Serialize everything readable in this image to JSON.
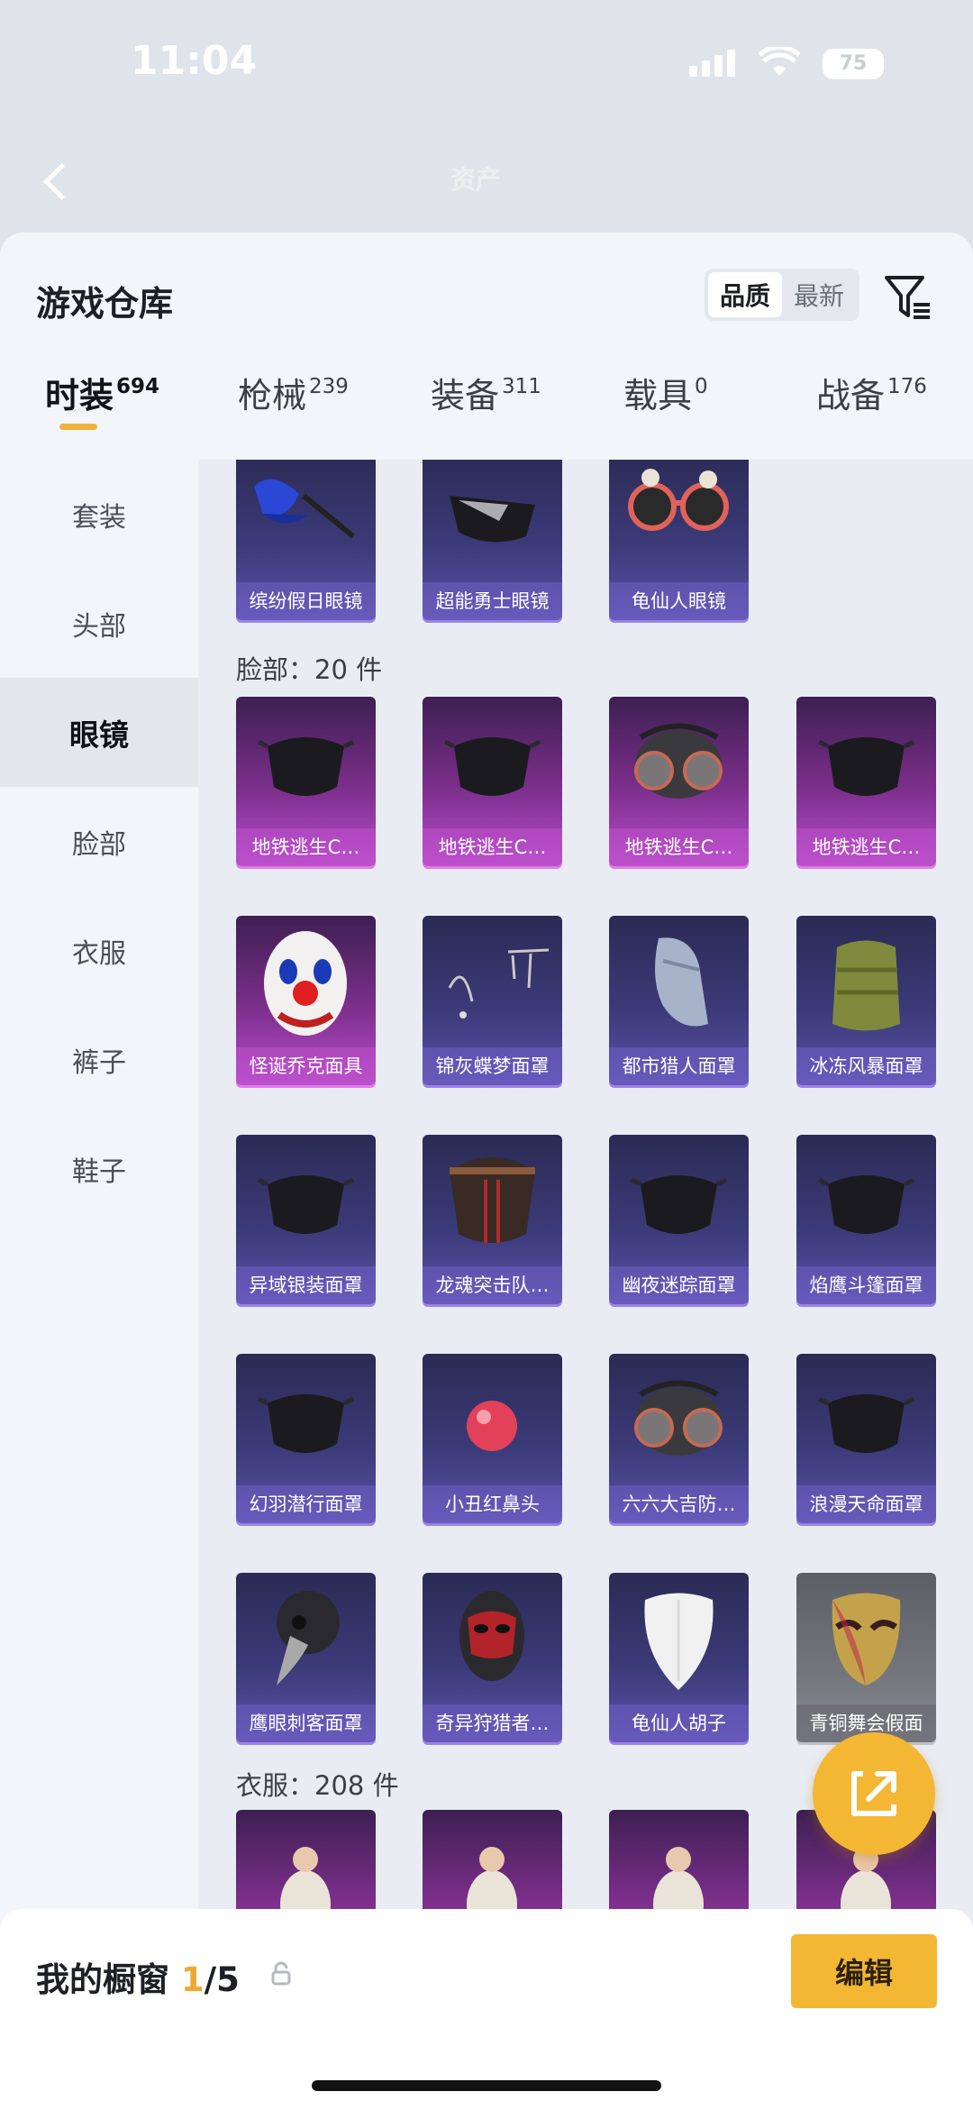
{
  "status": {
    "time": "11:04",
    "battery": "75"
  },
  "header_bg": {
    "title": "资产"
  },
  "sheet": {
    "title": "游戏仓库",
    "sort": [
      "品质",
      "最新"
    ],
    "sort_selected": "品质",
    "tabs": [
      {
        "label": "时装",
        "count": "694"
      },
      {
        "label": "枪械",
        "count": "239"
      },
      {
        "label": "装备",
        "count": "311"
      },
      {
        "label": "载具",
        "count": "0"
      },
      {
        "label": "战备",
        "count": "176"
      }
    ],
    "sidebar": [
      "套装",
      "头部",
      "眼镜",
      "脸部",
      "衣服",
      "裤子",
      "鞋子"
    ],
    "sidebar_selected": "眼镜",
    "glasses": [
      {
        "name": "缤纷假日眼镜",
        "tier": "blue",
        "icon": "sunglasses-icon"
      },
      {
        "name": "超能勇士眼镜",
        "tier": "blue",
        "icon": "visor-glasses-icon"
      },
      {
        "name": "龟仙人眼镜",
        "tier": "blue",
        "icon": "round-sunglasses-icon"
      }
    ],
    "face_header": "脸部：20 件",
    "face": [
      {
        "name": "地铁逃生C…",
        "tier": "purple",
        "icon": "mask-icon"
      },
      {
        "name": "地铁逃生C…",
        "tier": "purple",
        "icon": "mask-icon"
      },
      {
        "name": "地铁逃生C…",
        "tier": "purple",
        "icon": "gas-mask-icon"
      },
      {
        "name": "地铁逃生C…",
        "tier": "purple",
        "icon": "mask-icon"
      },
      {
        "name": "怪诞乔克面具",
        "tier": "purple",
        "icon": "clown-mask-icon"
      },
      {
        "name": "锦灰蝶梦面罩",
        "tier": "blue",
        "icon": "butterfly-icon"
      },
      {
        "name": "都市猎人面罩",
        "tier": "blue",
        "icon": "bandana-icon"
      },
      {
        "name": "冰冻风暴面罩",
        "tier": "blue",
        "icon": "neck-gaiter-icon"
      },
      {
        "name": "异域银装面罩",
        "tier": "blue",
        "icon": "mask-icon"
      },
      {
        "name": "龙魂突击队…",
        "tier": "blue",
        "icon": "assault-mask-icon"
      },
      {
        "name": "幽夜迷踪面罩",
        "tier": "blue",
        "icon": "mask-icon"
      },
      {
        "name": "焰鹰斗篷面罩",
        "tier": "blue",
        "icon": "mask-icon"
      },
      {
        "name": "幻羽潜行面罩",
        "tier": "blue",
        "icon": "mask-icon"
      },
      {
        "name": "小丑红鼻头",
        "tier": "blue",
        "icon": "red-nose-icon"
      },
      {
        "name": "六六大吉防…",
        "tier": "blue",
        "icon": "gas-mask-icon"
      },
      {
        "name": "浪漫天命面罩",
        "tier": "blue",
        "icon": "mask-icon"
      },
      {
        "name": "鹰眼刺客面罩",
        "tier": "blue",
        "icon": "plague-mask-icon"
      },
      {
        "name": "奇异狩猎者…",
        "tier": "blue",
        "icon": "balaclava-icon"
      },
      {
        "name": "龟仙人胡子",
        "tier": "blue",
        "icon": "beard-icon"
      },
      {
        "name": "青铜舞会假面",
        "tier": "grey",
        "icon": "masquerade-mask-icon"
      }
    ],
    "clothes_header": "衣服：208 件",
    "clothes_cards": 4
  },
  "showcase": {
    "title_prefix": "我的橱窗 ",
    "current": "1",
    "total": "/5",
    "edit_label": "编辑"
  },
  "colors": {
    "accent": "#f4b734",
    "blue_card": "#3b3a78",
    "purple_card": "#7d2f8c"
  }
}
